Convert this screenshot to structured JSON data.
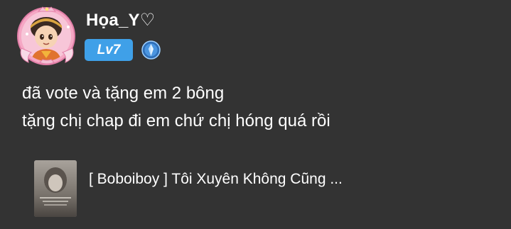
{
  "comment": {
    "user": {
      "name": "Họa_Y♡",
      "level": "Lv7",
      "rank_icon": "blue-rank-emblem-icon",
      "avatar": "boboiboy-avatar"
    },
    "lines": [
      "đã vote và tặng em 2 bông",
      "tặng chị chap đi em chứ chị hóng quá rồi"
    ],
    "book": {
      "title": "[ Boboiboy ] Tôi Xuyên Không Cũng ..."
    }
  },
  "colors": {
    "background": "#333333",
    "text": "#ffffff",
    "level_badge": "#3fa0e8",
    "avatar_frame": "#f5a7c4"
  }
}
